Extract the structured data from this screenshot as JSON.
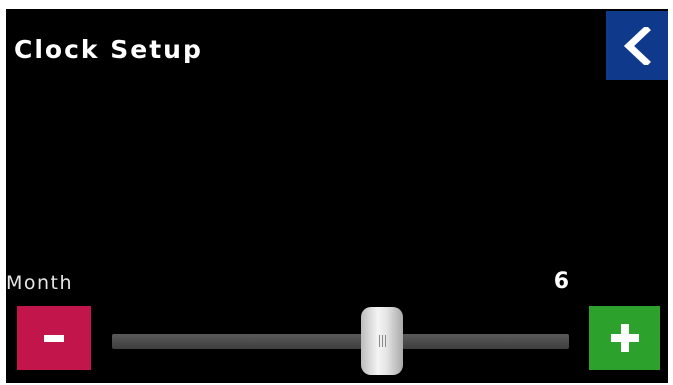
{
  "header": {
    "title": "Clock Setup"
  },
  "back_button": {
    "icon": "chevron-left-icon",
    "color": "#0f3a8c"
  },
  "slider": {
    "label": "Month",
    "value": "6",
    "min": 1,
    "max": 12,
    "decrement_label": "-",
    "increment_label": "+",
    "decrement_color": "#c1154c",
    "increment_color": "#2ca12c"
  }
}
